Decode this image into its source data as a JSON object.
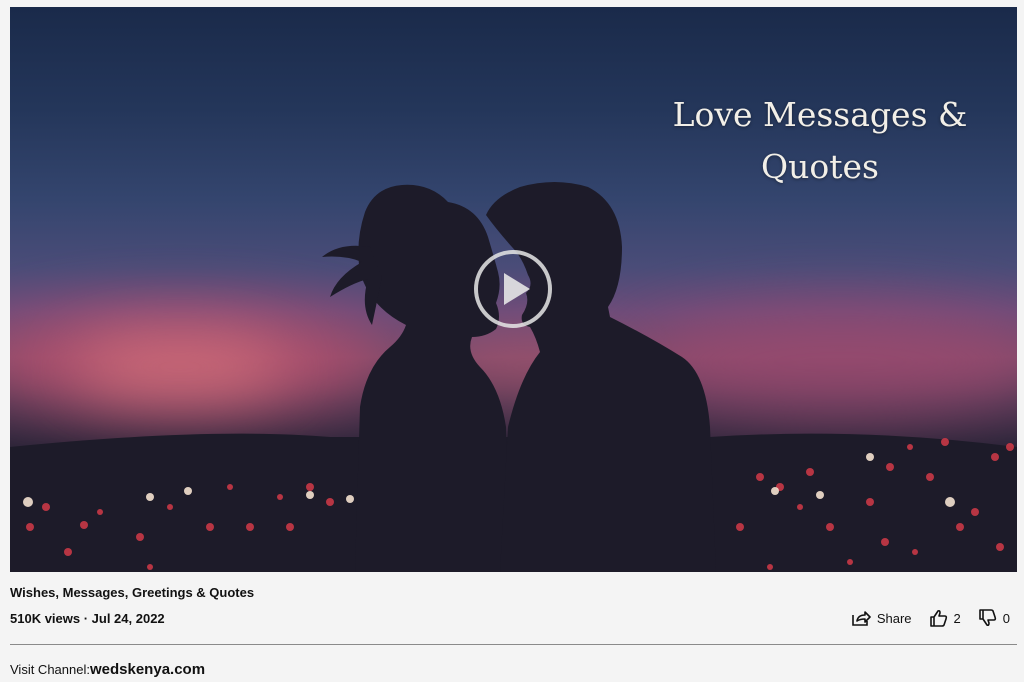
{
  "video": {
    "overlay_line1": "Love Messages &",
    "overlay_line2": "Quotes",
    "play_icon": "play-circle-icon"
  },
  "caption": "Wishes, Messages, Greetings & Quotes",
  "meta": "510K views · Jul 24, 2022",
  "actions": {
    "share_label": "Share",
    "likes": "2",
    "dislikes": "0"
  },
  "visit": {
    "label": "Visit Channel:",
    "link": "wedskenya.com"
  },
  "colors": {
    "sky_top": "#1a2a4a",
    "sky_glow": "#c05a78",
    "silhouette": "#1d1b29",
    "bokeh": "#d23a48"
  }
}
